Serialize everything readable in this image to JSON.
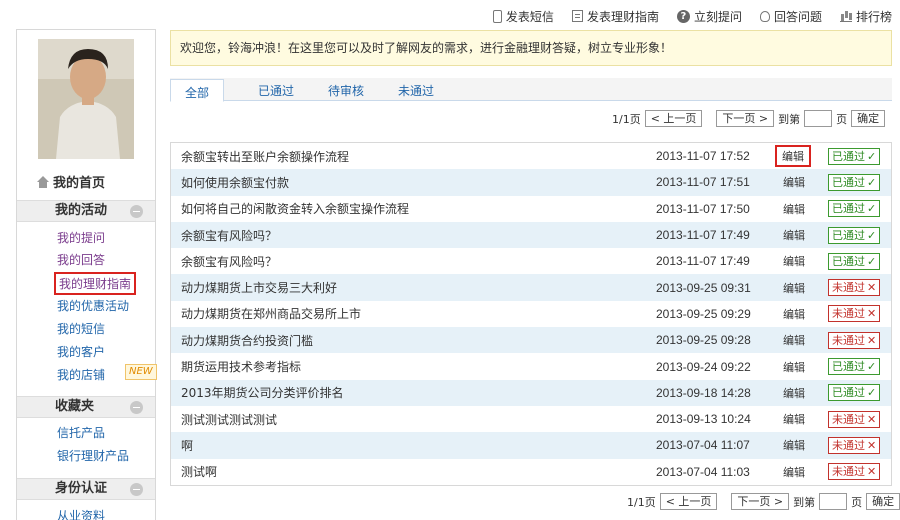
{
  "toplinks": [
    {
      "label": "发表短信",
      "icon": "phone-icon"
    },
    {
      "label": "发表理财指南",
      "icon": "document-icon"
    },
    {
      "label": "立刻提问",
      "icon": "question-icon"
    },
    {
      "label": "回答问题",
      "icon": "lightbulb-icon"
    },
    {
      "label": "排行榜",
      "icon": "rank-icon"
    }
  ],
  "sidebar": {
    "home_label": "我的首页",
    "activity_title": "我的活动",
    "activity_items": [
      "我的提问",
      "我的回答",
      "我的理财指南",
      "我的优惠活动",
      "我的短信",
      "我的客户",
      "我的店铺"
    ],
    "new_tag": "NEW",
    "favorites_title": "收藏夹",
    "favorites_items": [
      "信托产品",
      "银行理财产品"
    ],
    "identity_title": "身份认证",
    "identity_items": [
      "从业资料"
    ]
  },
  "notice": "欢迎您，铃海冲浪！在这里您可以及时了解网友的需求，进行金融理财答疑，树立专业形象！",
  "tabs": [
    "全部",
    "已通过",
    "待审核",
    "未通过"
  ],
  "pager": {
    "page_info": "1/1页",
    "prev": "< 上一页",
    "next": "下一页 >",
    "goto_prefix": "到第",
    "goto_suffix": "页",
    "confirm": "确定"
  },
  "rows": [
    {
      "title": "余额宝转出至账户余额操作流程",
      "date": "2013-11-07 17:52",
      "edit": "编辑",
      "status": "已通过"
    },
    {
      "title": "如何使用余额宝付款",
      "date": "2013-11-07 17:51",
      "edit": "编辑",
      "status": "已通过"
    },
    {
      "title": "如何将自己的闲散资金转入余额宝操作流程",
      "date": "2013-11-07 17:50",
      "edit": "编辑",
      "status": "已通过"
    },
    {
      "title": "余额宝有风险吗？",
      "date": "2013-11-07 17:49",
      "edit": "编辑",
      "status": "已通过"
    },
    {
      "title": "余额宝有风险吗？",
      "date": "2013-11-07 17:49",
      "edit": "编辑",
      "status": "已通过"
    },
    {
      "title": "动力煤期货上市交易三大利好",
      "date": "2013-09-25 09:31",
      "edit": "编辑",
      "status": "未通过"
    },
    {
      "title": "动力煤期货在郑州商品交易所上市",
      "date": "2013-09-25 09:29",
      "edit": "编辑",
      "status": "未通过"
    },
    {
      "title": "动力煤期货合约投资门槛",
      "date": "2013-09-25 09:28",
      "edit": "编辑",
      "status": "未通过"
    },
    {
      "title": "期货运用技术参考指标",
      "date": "2013-09-24 09:22",
      "edit": "编辑",
      "status": "已通过"
    },
    {
      "title": "2013年期货公司分类评价排名",
      "date": "2013-09-18 14:28",
      "edit": "编辑",
      "status": "已通过"
    },
    {
      "title": "测试测试测试测试",
      "date": "2013-09-13 10:24",
      "edit": "编辑",
      "status": "未通过"
    },
    {
      "title": "啊",
      "date": "2013-07-04 11:07",
      "edit": "编辑",
      "status": "未通过"
    },
    {
      "title": "测试啊",
      "date": "2013-07-04 11:03",
      "edit": "编辑",
      "status": "未通过"
    }
  ],
  "colors": {
    "pass": "#2d8a22",
    "fail": "#c2322c",
    "link": "#2266aa",
    "highlight": "#d9231f",
    "row_alt": "#e6f1f8"
  }
}
